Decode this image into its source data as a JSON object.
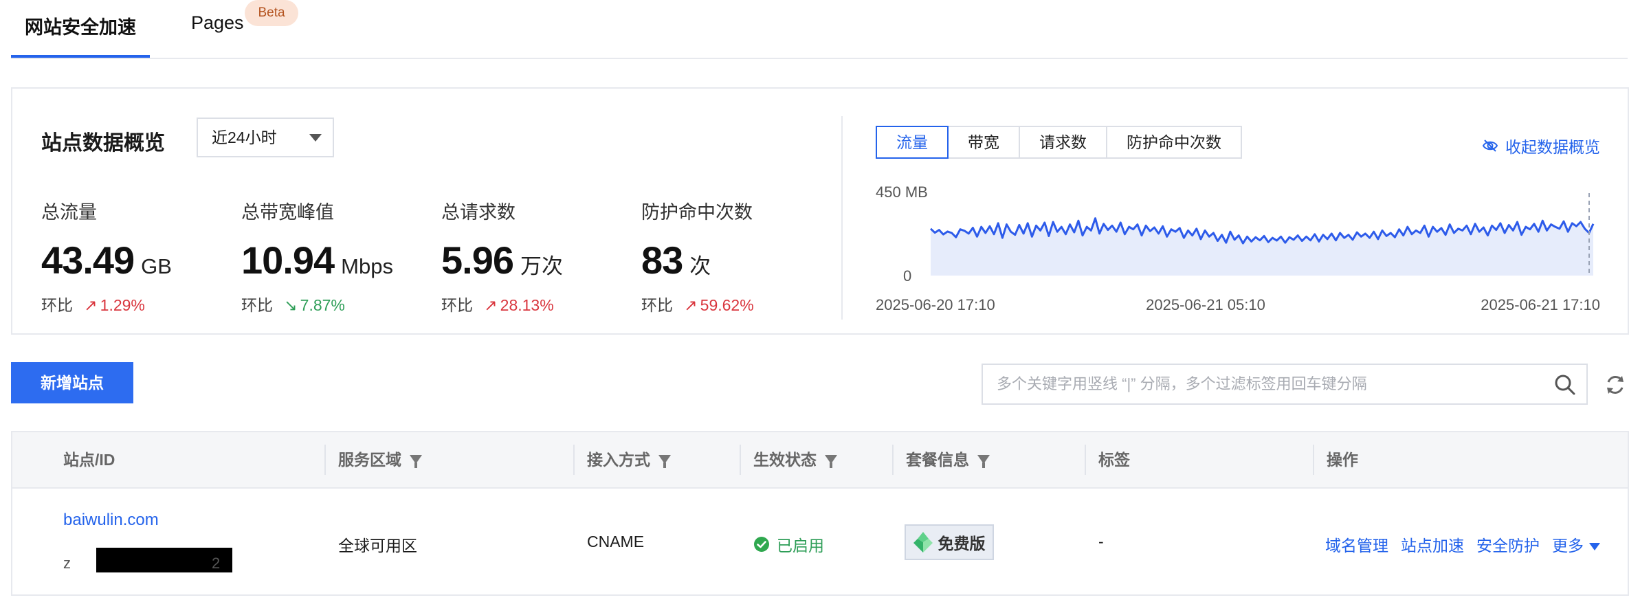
{
  "tabs": {
    "main": "网站安全加速",
    "pages": "Pages",
    "pages_badge": "Beta"
  },
  "overview": {
    "title": "站点数据概览",
    "range": "近24小时",
    "metrics": [
      {
        "label": "总流量",
        "value": "43.49",
        "unit": "GB",
        "cmp_label": "环比",
        "cmp_value": "1.29%",
        "trend": "up"
      },
      {
        "label": "总带宽峰值",
        "value": "10.94",
        "unit": "Mbps",
        "cmp_label": "环比",
        "cmp_value": "7.87%",
        "trend": "down"
      },
      {
        "label": "总请求数",
        "value": "5.96",
        "unit": "万次",
        "cmp_label": "环比",
        "cmp_value": "28.13%",
        "trend": "up"
      },
      {
        "label": "防护命中次数",
        "value": "83",
        "unit": "次",
        "cmp_label": "环比",
        "cmp_value": "59.62%",
        "trend": "up"
      }
    ],
    "chart_tabs": [
      "流量",
      "带宽",
      "请求数",
      "防护命中次数"
    ],
    "active_chart_tab": "流量",
    "collapse_label": "收起数据概览"
  },
  "chart_data": {
    "type": "area",
    "series": [
      {
        "values": [
          215,
          182,
          205,
          168,
          192,
          180,
          145,
          210,
          198,
          175,
          222,
          150,
          230,
          180,
          235,
          170,
          260,
          140,
          250,
          190,
          165,
          245,
          175,
          260,
          150,
          240,
          200,
          265,
          155,
          270,
          190,
          230,
          170,
          250,
          185,
          280,
          160,
          230,
          200,
          300,
          175,
          255,
          205,
          240,
          190,
          265,
          170,
          230,
          210,
          250,
          160,
          240,
          195,
          225,
          175,
          235,
          150,
          210,
          190,
          220,
          140,
          200,
          160,
          215,
          130,
          200,
          150,
          180,
          115,
          165,
          100,
          190,
          125,
          160,
          95,
          150,
          110,
          145,
          120,
          155,
          105,
          140,
          118,
          150,
          100,
          145,
          125,
          160,
          115,
          150,
          120,
          170,
          110,
          165,
          130,
          175,
          120,
          180,
          140,
          165,
          125,
          185,
          150,
          175,
          140,
          190,
          130,
          200,
          155,
          180,
          145,
          210,
          160,
          230,
          170,
          200,
          180,
          240,
          150,
          230,
          190,
          220,
          165,
          250,
          180,
          215,
          200,
          240,
          170,
          255,
          190,
          225,
          160,
          240,
          205,
          260,
          180,
          245,
          200,
          270,
          165,
          230,
          210,
          255,
          190,
          280,
          200,
          250,
          230,
          215,
          275,
          190,
          260,
          235,
          270,
          215,
          180,
          255
        ]
      }
    ],
    "x_ticks": [
      "2025-06-20 17:10",
      "2025-06-21 05:10",
      "2025-06-21 17:10"
    ],
    "y_ticks": [
      "450 MB",
      "0"
    ],
    "ylim": [
      0,
      450
    ],
    "color": "#2d5bea",
    "fill": "#e6ecfb"
  },
  "toolbar": {
    "add_label": "新增站点",
    "search_placeholder": "多个关键字用竖线 “|” 分隔，多个过滤标签用回车键分隔"
  },
  "table": {
    "headers": [
      "站点/ID",
      "服务区域",
      "接入方式",
      "生效状态",
      "套餐信息",
      "标签",
      "操作"
    ],
    "rows": [
      {
        "domain": "baiwulin.com",
        "id_prefix": "z",
        "id_suffix": "2",
        "region": "全球可用区",
        "access": "CNAME",
        "status": "已启用",
        "plan": "免费版",
        "tags": "-",
        "actions": [
          "域名管理",
          "站点加速",
          "安全防护",
          "更多"
        ]
      }
    ]
  }
}
